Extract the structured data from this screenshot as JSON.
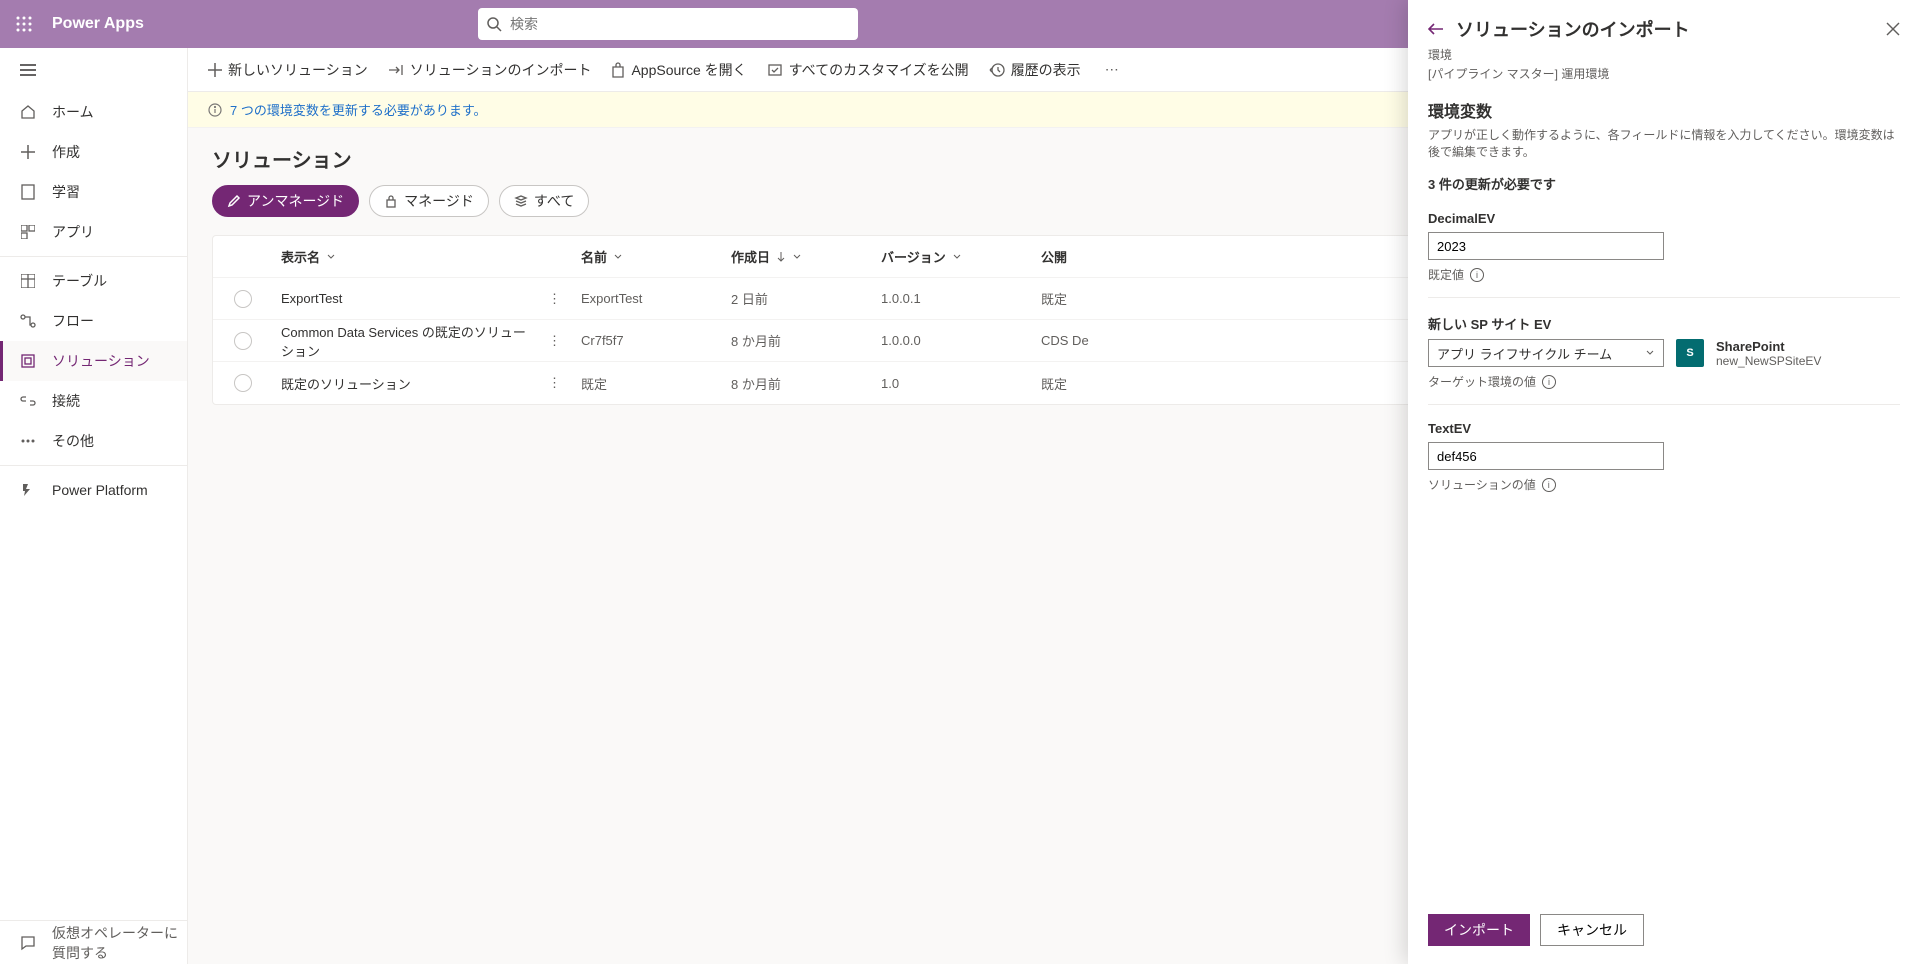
{
  "header": {
    "brand": "Power Apps",
    "search_placeholder": "検索"
  },
  "nav": {
    "items": [
      {
        "label": "ホーム"
      },
      {
        "label": "作成"
      },
      {
        "label": "学習"
      },
      {
        "label": "アプリ"
      },
      {
        "label": "テーブル"
      },
      {
        "label": "フロー"
      },
      {
        "label": "ソリューション"
      },
      {
        "label": "接続"
      },
      {
        "label": "その他"
      }
    ],
    "pp": "Power Platform",
    "footer": "仮想オペレーターに質問する"
  },
  "cmd": {
    "new": "新しいソリューション",
    "import": "ソリューションのインポート",
    "appsource": "AppSource を開く",
    "publish": "すべてのカスタマイズを公開",
    "history": "履歴の表示"
  },
  "msg": "7 つの環境変数を更新する必要があります。",
  "page_title": "ソリューション",
  "pills": {
    "unmanaged": "アンマネージド",
    "managed": "マネージド",
    "all": "すべて"
  },
  "table": {
    "headers": {
      "display": "表示名",
      "name": "名前",
      "created": "作成日",
      "version": "バージョン",
      "publish": "公開"
    },
    "rows": [
      {
        "display": "ExportTest",
        "name": "ExportTest",
        "created": "2 日前",
        "version": "1.0.0.1",
        "publish": "既定"
      },
      {
        "display": "Common Data Services の既定のソリューション",
        "name": "Cr7f5f7",
        "created": "8 か月前",
        "version": "1.0.0.0",
        "publish": "CDS De"
      },
      {
        "display": "既定のソリューション",
        "name": "既定",
        "created": "8 か月前",
        "version": "1.0",
        "publish": "既定"
      }
    ]
  },
  "panel": {
    "title": "ソリューションのインポート",
    "env_label": "環境",
    "env_value": "[パイプライン マスター] 運用環境",
    "section_title": "環境変数",
    "section_desc": "アプリが正しく動作するように、各フィールドに情報を入力してください。環境変数は後で編集できます。",
    "updates_required": "3 件の更新が必要です",
    "fields": {
      "decimal": {
        "label": "DecimalEV",
        "value": "2023",
        "help": "既定値"
      },
      "spsite": {
        "label": "新しい SP サイト EV",
        "value": "アプリ ライフサイクル チーム",
        "help": "ターゲット環境の値",
        "conn_name": "SharePoint",
        "conn_id": "new_NewSPSiteEV"
      },
      "text": {
        "label": "TextEV",
        "value": "def456",
        "help": "ソリューションの値"
      }
    },
    "import_btn": "インポート",
    "cancel_btn": "キャンセル"
  }
}
